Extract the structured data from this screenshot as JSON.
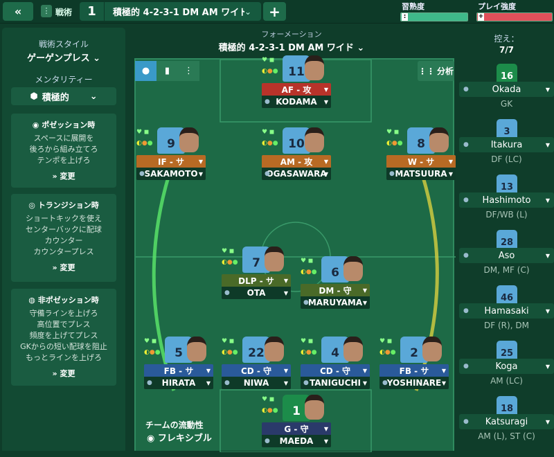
{
  "topbar": {
    "tactics_label": "戦術",
    "slot_number": "1",
    "slot_name": "積極的 4-2-3-1 DM AM ワイド…",
    "familiarity_label": "習熟度",
    "intensity_label": "プレイ強度",
    "familiarity_pct": 100,
    "intensity_pct": 100,
    "familiarity_color": "#3fb98a",
    "intensity_color": "#e0505a"
  },
  "sidebar": {
    "style_label": "戦術スタイル",
    "style_value": "ゲーゲンプレス",
    "mentality_label": "メンタリティー",
    "mentality_value": "積極的",
    "in_possession": {
      "title": "ポゼッション時",
      "lines": [
        "スペースに展開を",
        "後ろから組み立てろ",
        "テンポを上げろ"
      ],
      "change": "変更"
    },
    "transition": {
      "title": "トランジション時",
      "lines": [
        "ショートキックを使え",
        "センターバックに配球",
        "カウンター",
        "カウンタープレス"
      ],
      "change": "変更"
    },
    "out_possession": {
      "title": "非ポゼッション時",
      "lines": [
        "守備ラインを上げろ",
        "高位置でプレス",
        "頻度を上げてプレス",
        "GKからの短い配球を阻止",
        "もっとラインを上げろ"
      ],
      "change": "変更"
    }
  },
  "pitch": {
    "formation_label": "フォーメーション",
    "formation_name": "積極的 4-2-3-1 DM AM ワイド",
    "analysis_label": "分析",
    "fluidity_label": "チームの流動性",
    "fluidity_value": "フレキシブル"
  },
  "players": [
    {
      "number": "11",
      "role": "AF - 攻",
      "name": "KODAMA",
      "role_color": "#b8332a"
    },
    {
      "number": "9",
      "role": "IF - サ",
      "name": "SAKAMOTO",
      "role_color": "#b86a24"
    },
    {
      "number": "10",
      "role": "AM - 攻",
      "name": "OGASAWARA",
      "role_color": "#b86a24"
    },
    {
      "number": "8",
      "role": "W - サ",
      "name": "MATSUURA",
      "role_color": "#b86a24"
    },
    {
      "number": "7",
      "role": "DLP - サ",
      "name": "OTA",
      "role_color": "#4a6a28"
    },
    {
      "number": "6",
      "role": "DM - 守",
      "name": "MARUYAMA",
      "role_color": "#4a6a28"
    },
    {
      "number": "5",
      "role": "FB - サ",
      "name": "HIRATA",
      "role_color": "#2a5a9a"
    },
    {
      "number": "22",
      "role": "CD - 守",
      "name": "NIWA",
      "role_color": "#2a5a9a"
    },
    {
      "number": "4",
      "role": "CD - 守",
      "name": "TANIGUCHI",
      "role_color": "#2a5a9a"
    },
    {
      "number": "2",
      "role": "FB - サ",
      "name": "YOSHINARE",
      "role_color": "#2a5a9a"
    },
    {
      "number": "1",
      "role": "G - 守",
      "name": "MAEDA",
      "role_color": "#2a3a6a"
    }
  ],
  "subs": {
    "header": "控え：",
    "count": "7/7",
    "list": [
      {
        "number": "16",
        "name": "Okada",
        "pos": "GK"
      },
      {
        "number": "3",
        "name": "Itakura",
        "pos": "DF (LC)"
      },
      {
        "number": "13",
        "name": "Hashimoto",
        "pos": "DF/WB (L)"
      },
      {
        "number": "28",
        "name": "Aso",
        "pos": "DM, MF (C)"
      },
      {
        "number": "46",
        "name": "Hamasaki",
        "pos": "DF (R), DM"
      },
      {
        "number": "25",
        "name": "Koga",
        "pos": "AM (LC)"
      },
      {
        "number": "18",
        "name": "Katsuragi",
        "pos": "AM (L), ST (C)"
      }
    ]
  }
}
